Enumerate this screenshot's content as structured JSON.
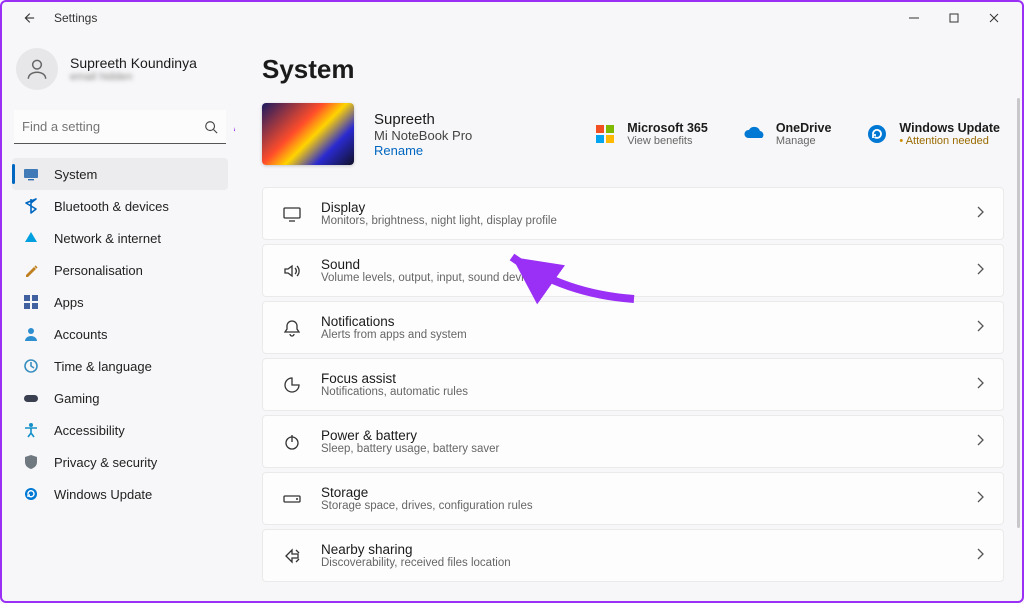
{
  "app": {
    "title": "Settings"
  },
  "user": {
    "name": "Supreeth Koundinya",
    "subtitle": "email hidden"
  },
  "search": {
    "placeholder": "Find a setting"
  },
  "sidebar": {
    "items": [
      {
        "label": "System",
        "icon": "system",
        "selected": true
      },
      {
        "label": "Bluetooth & devices",
        "icon": "bluetooth",
        "selected": false
      },
      {
        "label": "Network & internet",
        "icon": "network",
        "selected": false
      },
      {
        "label": "Personalisation",
        "icon": "personalise",
        "selected": false
      },
      {
        "label": "Apps",
        "icon": "apps",
        "selected": false
      },
      {
        "label": "Accounts",
        "icon": "accounts",
        "selected": false
      },
      {
        "label": "Time & language",
        "icon": "time",
        "selected": false
      },
      {
        "label": "Gaming",
        "icon": "gaming",
        "selected": false
      },
      {
        "label": "Accessibility",
        "icon": "accessibility",
        "selected": false
      },
      {
        "label": "Privacy & security",
        "icon": "privacy",
        "selected": false
      },
      {
        "label": "Windows Update",
        "icon": "update",
        "selected": false
      }
    ]
  },
  "page": {
    "title": "System"
  },
  "device": {
    "name": "Supreeth",
    "model": "Mi NoteBook Pro",
    "rename_label": "Rename"
  },
  "quick_links": [
    {
      "title": "Microsoft 365",
      "subtitle": "View benefits",
      "icon": "ms365",
      "attn": false
    },
    {
      "title": "OneDrive",
      "subtitle": "Manage",
      "icon": "onedrive",
      "attn": false
    },
    {
      "title": "Windows Update",
      "subtitle": "Attention needed",
      "icon": "update",
      "attn": true
    }
  ],
  "system_rows": [
    {
      "title": "Display",
      "subtitle": "Monitors, brightness, night light, display profile",
      "icon": "display"
    },
    {
      "title": "Sound",
      "subtitle": "Volume levels, output, input, sound devices",
      "icon": "sound"
    },
    {
      "title": "Notifications",
      "subtitle": "Alerts from apps and system",
      "icon": "notifications"
    },
    {
      "title": "Focus assist",
      "subtitle": "Notifications, automatic rules",
      "icon": "focus"
    },
    {
      "title": "Power & battery",
      "subtitle": "Sleep, battery usage, battery saver",
      "icon": "power"
    },
    {
      "title": "Storage",
      "subtitle": "Storage space, drives, configuration rules",
      "icon": "storage"
    },
    {
      "title": "Nearby sharing",
      "subtitle": "Discoverability, received files location",
      "icon": "nearby"
    }
  ],
  "icons": {
    "system": "#2f6fb0",
    "bluetooth": "#0067c0",
    "network": "#00a0e0",
    "personalise": "#c08020",
    "apps": "#4060a0",
    "accounts": "#2d8fd0",
    "time": "#3a90c0",
    "gaming": "#3a4050",
    "accessibility": "#1590c8",
    "privacy": "#707880",
    "update": "#0078d4",
    "ms365": "#f25022",
    "onedrive": "#0078d4"
  }
}
